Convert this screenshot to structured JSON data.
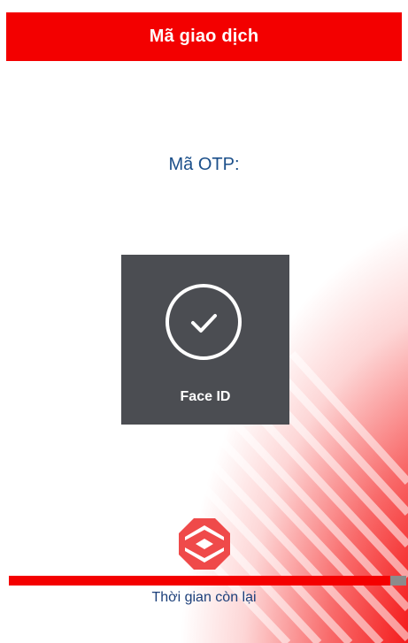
{
  "header": {
    "title": "Mã giao dịch"
  },
  "otp": {
    "label": "Mã OTP:"
  },
  "face_id": {
    "label": "Face ID",
    "icon": "check-circle-icon"
  },
  "brand": {
    "logo_icon": "bank-logo-icon"
  },
  "timer": {
    "label": "Thời gian còn lại",
    "progress_fraction": 0.96
  },
  "colors": {
    "brand_red": "#f30000",
    "text_blue": "#1b4f8a",
    "tile_gray": "#4b4d52",
    "track_gray": "#8b8b8b"
  }
}
